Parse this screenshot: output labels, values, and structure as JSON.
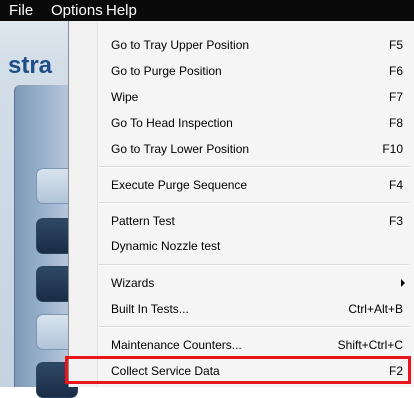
{
  "menubar": {
    "file": "File",
    "options": "Options",
    "help": "Help"
  },
  "app": {
    "brand": "stra"
  },
  "options_menu": {
    "items": [
      {
        "label": "Go to Tray Upper Position",
        "shortcut": "F5"
      },
      {
        "label": "Go to Purge Position",
        "shortcut": "F6"
      },
      {
        "label": "Wipe",
        "shortcut": "F7"
      },
      {
        "label": "Go To Head Inspection",
        "shortcut": "F8"
      },
      {
        "label": "Go to Tray Lower Position",
        "shortcut": "F10"
      },
      {
        "label": "Execute Purge Sequence",
        "shortcut": "F4"
      },
      {
        "label": "Pattern Test",
        "shortcut": "F3"
      },
      {
        "label": "Dynamic Nozzle test",
        "shortcut": ""
      },
      {
        "label": "Wizards",
        "shortcut": "",
        "submenu": true
      },
      {
        "label": "Built In Tests...",
        "shortcut": "Ctrl+Alt+B"
      },
      {
        "label": "Maintenance Counters...",
        "shortcut": "Shift+Ctrl+C"
      },
      {
        "label": "Collect Service Data",
        "shortcut": "F2"
      }
    ]
  },
  "colors": {
    "highlight": "#e8151b",
    "menubar": "#0a0a0a",
    "brand": "#1e4f86"
  }
}
